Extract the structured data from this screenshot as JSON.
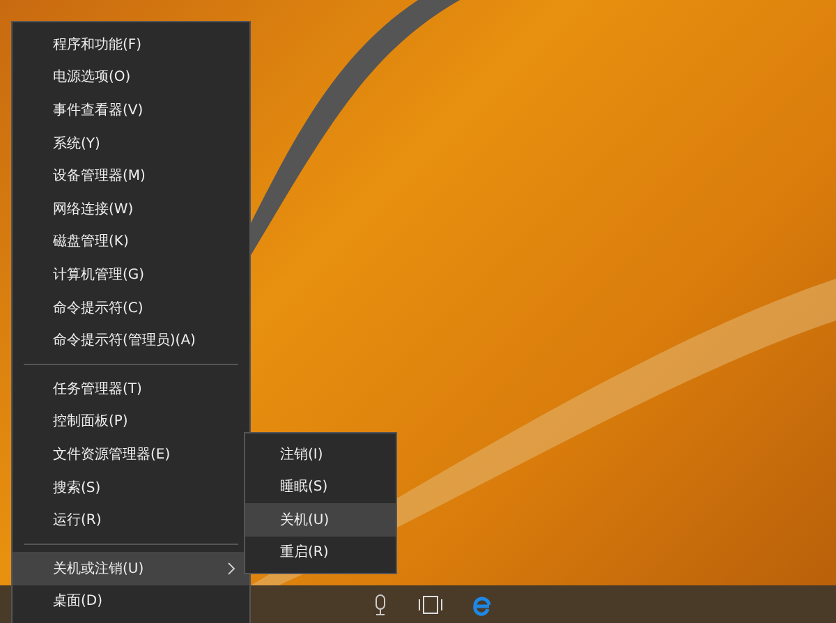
{
  "context_menu": {
    "groups": [
      [
        {
          "label": "程序和功能(F)",
          "selected": false,
          "submenu": false
        },
        {
          "label": "电源选项(O)",
          "selected": false,
          "submenu": false
        },
        {
          "label": "事件查看器(V)",
          "selected": false,
          "submenu": false
        },
        {
          "label": "系统(Y)",
          "selected": false,
          "submenu": false
        },
        {
          "label": "设备管理器(M)",
          "selected": false,
          "submenu": false
        },
        {
          "label": "网络连接(W)",
          "selected": false,
          "submenu": false
        },
        {
          "label": "磁盘管理(K)",
          "selected": false,
          "submenu": false
        },
        {
          "label": "计算机管理(G)",
          "selected": false,
          "submenu": false
        },
        {
          "label": "命令提示符(C)",
          "selected": false,
          "submenu": false
        },
        {
          "label": "命令提示符(管理员)(A)",
          "selected": false,
          "submenu": false
        }
      ],
      [
        {
          "label": "任务管理器(T)",
          "selected": false,
          "submenu": false
        },
        {
          "label": "控制面板(P)",
          "selected": false,
          "submenu": false
        },
        {
          "label": "文件资源管理器(E)",
          "selected": false,
          "submenu": false
        },
        {
          "label": "搜索(S)",
          "selected": false,
          "submenu": false
        },
        {
          "label": "运行(R)",
          "selected": false,
          "submenu": false
        }
      ],
      [
        {
          "label": "关机或注销(U)",
          "selected": true,
          "submenu": true
        },
        {
          "label": "桌面(D)",
          "selected": false,
          "submenu": false
        }
      ]
    ]
  },
  "submenu": {
    "items": [
      {
        "label": "注销(I)",
        "selected": false
      },
      {
        "label": "睡眠(S)",
        "selected": false
      },
      {
        "label": "关机(U)",
        "selected": true
      },
      {
        "label": "重启(R)",
        "selected": false
      }
    ]
  }
}
